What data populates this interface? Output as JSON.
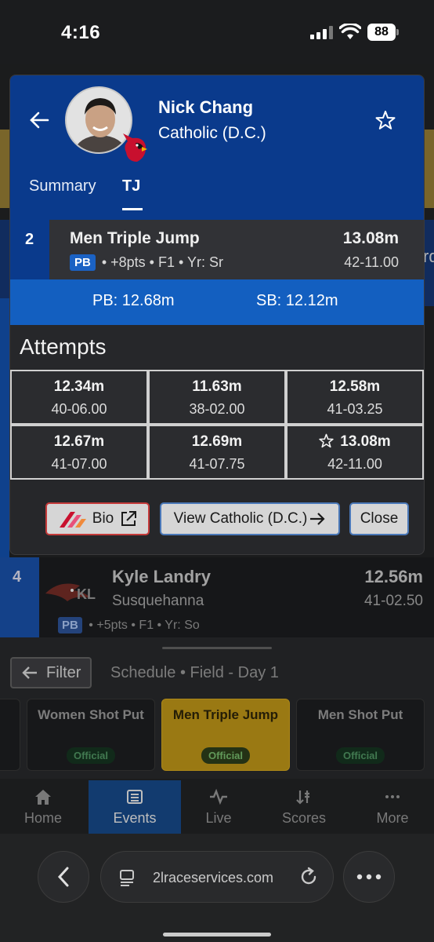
{
  "status": {
    "time": "4:16",
    "battery": "88"
  },
  "background": {
    "right_letter": "rd",
    "row4": {
      "rank": "4",
      "logo_text": "KL",
      "name": "Kyle Landry",
      "school": "Susquehanna",
      "mark": "12.56m",
      "imperial": "41-02.50",
      "pb": "PB",
      "meta": "• +5pts • F1 • Yr: So"
    }
  },
  "modal": {
    "name": "Nick Chang",
    "school": "Catholic (D.C.)",
    "tabs": [
      "Summary",
      "TJ"
    ],
    "result": {
      "rank": "2",
      "event": "Men Triple Jump",
      "pb_badge": "PB",
      "meta": "• +8pts • F1 • Yr: Sr",
      "mark": "13.08m",
      "imperial": "42-11.00"
    },
    "pb_line": "PB: 12.68m",
    "sb_line": "SB: 12.12m",
    "attempts_title": "Attempts",
    "attempts": [
      {
        "mark": "12.34m",
        "imperial": "40-06.00",
        "best": false
      },
      {
        "mark": "11.63m",
        "imperial": "38-02.00",
        "best": false
      },
      {
        "mark": "12.58m",
        "imperial": "41-03.25",
        "best": false
      },
      {
        "mark": "12.67m",
        "imperial": "41-07.00",
        "best": false
      },
      {
        "mark": "12.69m",
        "imperial": "41-07.75",
        "best": false
      },
      {
        "mark": "13.08m",
        "imperial": "42-11.00",
        "best": true
      }
    ],
    "buttons": {
      "bio": "Bio",
      "view": "View Catholic (D.C.)",
      "close": "Close"
    }
  },
  "sheet": {
    "filter": "Filter",
    "schedule": "Schedule • Field - Day 1",
    "events": [
      {
        "title": "Women Shot Put",
        "status": "Official",
        "active": false
      },
      {
        "title": "Men Triple Jump",
        "status": "Official",
        "active": true
      },
      {
        "title": "Men Shot Put",
        "status": "Official",
        "active": false
      }
    ]
  },
  "tabbar": {
    "items": [
      {
        "label": "Home",
        "icon": "home-icon"
      },
      {
        "label": "Events",
        "icon": "list-icon"
      },
      {
        "label": "Live",
        "icon": "pulse-icon"
      },
      {
        "label": "Scores",
        "icon": "sort-icon"
      },
      {
        "label": "More",
        "icon": "more-icon"
      }
    ],
    "active": "Events"
  },
  "browser": {
    "url": "2lraceservices.com"
  }
}
